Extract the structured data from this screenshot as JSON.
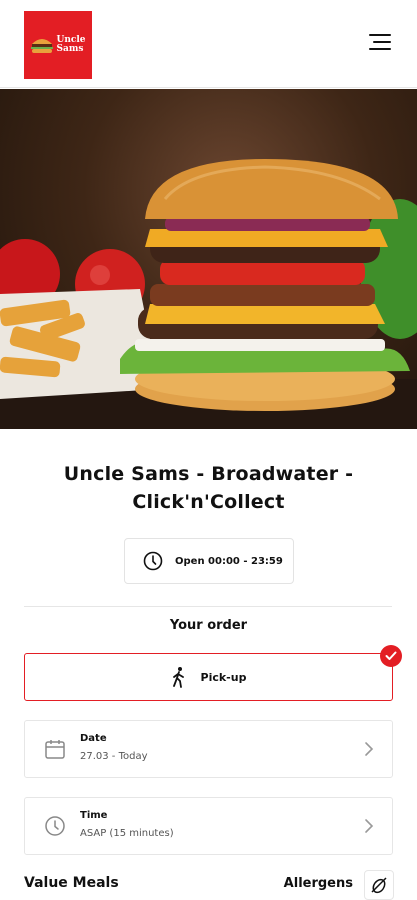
{
  "header": {
    "logo_text_line1": "Uncle",
    "logo_text_line2": "Sams",
    "menu_icon": "hamburger-menu-icon",
    "brand_color": "#e31e24"
  },
  "hero": {
    "image_subject": "burger-and-fries-photo"
  },
  "restaurant": {
    "title_line1": "Uncle Sams - Broadwater -",
    "title_line2": "Click'n'Collect",
    "hours": "Open 00:00 - 23:59",
    "hours_icon": "clock-icon"
  },
  "order": {
    "heading": "Your order",
    "method": "Pick-up",
    "method_icon": "walking-person-icon",
    "selected_icon": "check-icon",
    "date_label": "Date",
    "date_value": "27.03 - Today",
    "date_icon": "calendar-icon",
    "time_label": "Time",
    "time_value": "ASAP (15 minutes)",
    "time_icon": "clock-icon"
  },
  "menu": {
    "section_title": "Value Meals",
    "allergens_label": "Allergens",
    "allergens_icon": "allergen-icon"
  }
}
